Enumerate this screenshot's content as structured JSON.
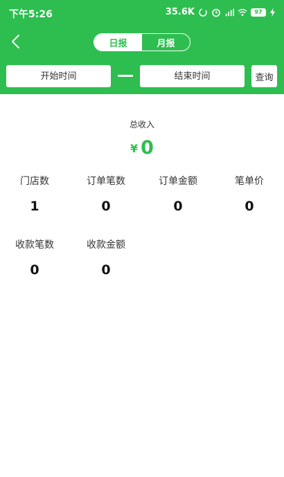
{
  "status_bar": {
    "time": "下午5:26",
    "network_speed": "35.6K",
    "battery_level": "97"
  },
  "nav": {
    "tabs": [
      {
        "label": "日报",
        "active": true
      },
      {
        "label": "月报",
        "active": false
      }
    ]
  },
  "filter": {
    "start_placeholder": "开始时间",
    "end_placeholder": "结束时间",
    "query_label": "查询"
  },
  "summary": {
    "total_label": "总收入",
    "currency": "¥",
    "total_value": "0"
  },
  "stats_row1": [
    {
      "label": "门店数",
      "value": "1"
    },
    {
      "label": "订单笔数",
      "value": "0"
    },
    {
      "label": "订单金额",
      "value": "0"
    },
    {
      "label": "笔单价",
      "value": "0"
    }
  ],
  "stats_row2": [
    {
      "label": "收款笔数",
      "value": "0"
    },
    {
      "label": "收款金额",
      "value": "0"
    }
  ],
  "colors": {
    "accent": "#2dbe4f",
    "background": "#ffffff"
  }
}
